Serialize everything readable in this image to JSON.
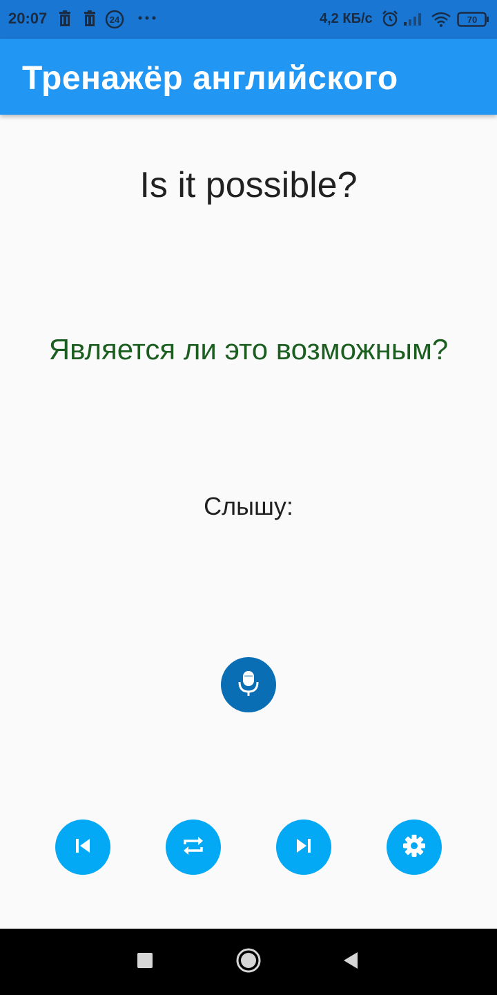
{
  "status_bar": {
    "time": "20:07",
    "notification_icons": [
      "trash-icon",
      "trash-icon",
      "badge-24-icon",
      "more-dots-icon"
    ],
    "badge_number": "24",
    "network_speed": "4,2 КБ/с",
    "battery": "70",
    "system_icons": [
      "alarm-icon",
      "signal-icon",
      "wifi-icon",
      "battery-icon"
    ]
  },
  "app_bar": {
    "title": "Тренажёр английского",
    "color": "#2196F3"
  },
  "trainer": {
    "english_phrase": "Is it possible?",
    "russian_translation": "Является ли это возможным?",
    "heard_label": "Слышу:",
    "translation_color": "#1B5E20"
  },
  "controls": {
    "mic_icon": "microphone-icon",
    "buttons": [
      {
        "name": "previous-button",
        "icon": "skip-previous-icon"
      },
      {
        "name": "repeat-button",
        "icon": "repeat-icon"
      },
      {
        "name": "next-button",
        "icon": "skip-next-icon"
      },
      {
        "name": "settings-button",
        "icon": "gear-icon"
      }
    ],
    "button_color": "#03A9F4",
    "mic_color": "#0A6EB4"
  },
  "nav_bar": {
    "buttons": [
      "recents-square-icon",
      "home-circle-icon",
      "back-triangle-icon"
    ]
  }
}
